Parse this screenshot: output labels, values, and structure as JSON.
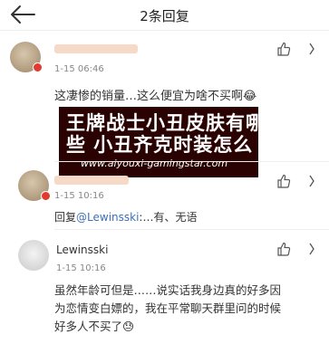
{
  "header": {
    "title": "2条回复"
  },
  "comments": [
    {
      "time": "1-15 06:46",
      "text": "这凄惨的销量…这么便宜为啥不买啊",
      "emoji": "😂"
    },
    {
      "time": "1-15 10:16",
      "reply_prefix": "回复",
      "mention": "@Lewinsski",
      "reply_text": ":…有、无语"
    },
    {
      "name": "Lewinsski",
      "time": "1-15 10:16",
      "text_line1": "虽然年龄可但是……说实话我身边真的好多因",
      "text_line2": "为恋情变白嫖的，我在平常聊天群里问的时候",
      "text_line3": "好多人不买了",
      "emoji": "😓"
    }
  ],
  "banner": {
    "title_line1": "王牌战士小丑皮肤有哪",
    "title_line2": "些 小丑齐克时装怎么",
    "url": "www.aiyouxi-gamingstar.com"
  },
  "colors": {
    "vip": "#e03b2e",
    "mention": "#3f6fb5",
    "banner_bg": "#2a0202"
  }
}
